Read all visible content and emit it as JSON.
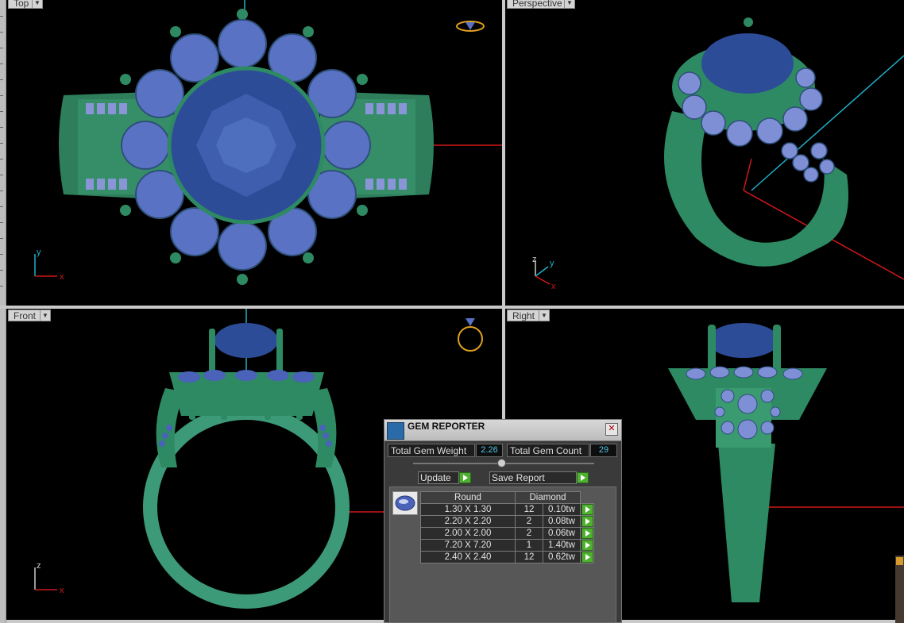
{
  "viewports": {
    "top": {
      "label": "Top"
    },
    "perspective": {
      "label": "Perspective"
    },
    "front": {
      "label": "Front"
    },
    "right": {
      "label": "Right"
    }
  },
  "axes": {
    "top": [
      "y",
      "x"
    ],
    "perspective": [
      "z",
      "y",
      "x"
    ],
    "front": [
      "z",
      "x"
    ]
  },
  "colors": {
    "metal": "#2e8a62",
    "stone": "#4a62b8",
    "axis_x": "#d01818",
    "axis_y": "#1fb0c8"
  },
  "gem_reporter": {
    "title": "GEM REPORTER",
    "close_icon": "✕",
    "total_weight_label": "Total Gem Weight",
    "total_weight_value": "2.26",
    "total_count_label": "Total Gem Count",
    "total_count_value": "29",
    "update_label": "Update",
    "save_report_label": "Save Report",
    "table": {
      "col_shape": "Round",
      "col_material": "Diamond",
      "rows": [
        {
          "size": "1.30 X 1.30",
          "count": "12",
          "weight": "0.10tw"
        },
        {
          "size": "2.20 X 2.20",
          "count": "2",
          "weight": "0.08tw"
        },
        {
          "size": "2.00 X 2.00",
          "count": "2",
          "weight": "0.06tw"
        },
        {
          "size": "7.20 X 7.20",
          "count": "1",
          "weight": "1.40tw"
        },
        {
          "size": "2.40 X 2.40",
          "count": "12",
          "weight": "0.62tw"
        }
      ]
    }
  }
}
